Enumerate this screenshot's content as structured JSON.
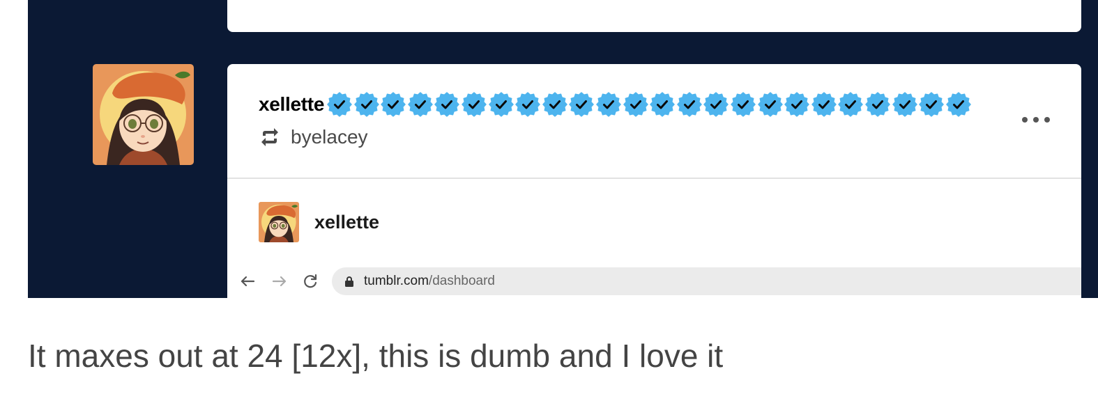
{
  "post": {
    "username": "xellette",
    "verified_badge_count": 24,
    "reblogged_from": "byelacey",
    "content_author": "xellette",
    "more_options": "more-options"
  },
  "browser": {
    "url_host": "tumblr.com",
    "url_path": "/dashboard"
  },
  "caption": "It maxes out at 24 [12x], this is dumb and I love it",
  "colors": {
    "dashboard_background": "#0b1934",
    "badge_blue": "#4db4ee",
    "card_background": "#ffffff"
  }
}
